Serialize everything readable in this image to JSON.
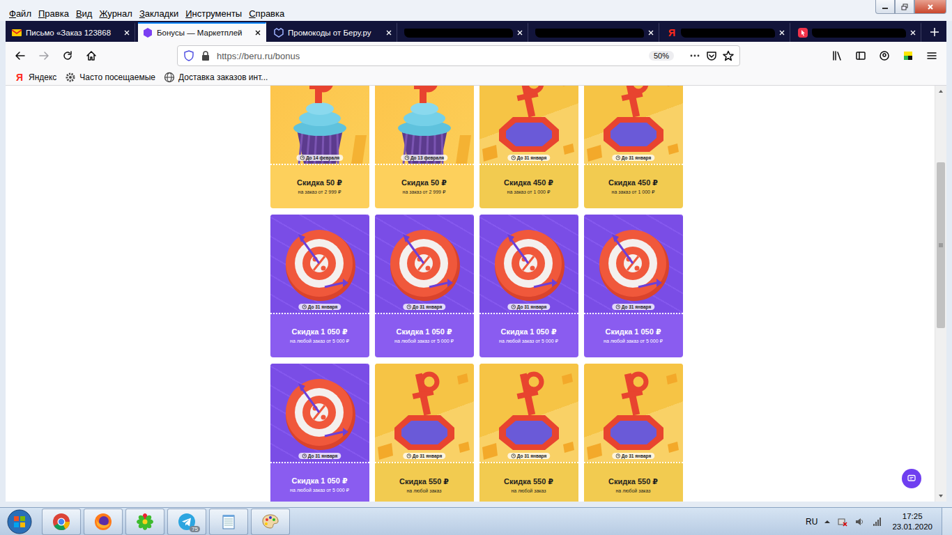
{
  "menu": [
    "Файл",
    "Правка",
    "Вид",
    "Журнал",
    "Закладки",
    "Инструменты",
    "Справка"
  ],
  "tabs": [
    {
      "label": "Письмо «Заказ 123868",
      "selected": false,
      "redacted": false,
      "icon_text": ""
    },
    {
      "label": "Бонусы — Маркетплей",
      "selected": true,
      "redacted": false,
      "icon_text": ""
    },
    {
      "label": "Промокоды от Беру.ру",
      "selected": false,
      "redacted": false,
      "icon_text": ""
    },
    {
      "label": "",
      "selected": false,
      "redacted": true,
      "icon_text": ""
    },
    {
      "label": "",
      "selected": false,
      "redacted": true,
      "icon_text": ""
    },
    {
      "label": "",
      "selected": false,
      "redacted": true,
      "icon_text": "Я"
    },
    {
      "label": "",
      "selected": false,
      "redacted": true,
      "icon_text": ""
    }
  ],
  "address": {
    "url": "https://beru.ru/bonus",
    "zoom": "50%"
  },
  "bookmarks": [
    {
      "label": "Яндекс",
      "icon_text": "Я"
    },
    {
      "label": "Часто посещаемые",
      "icon_text": ""
    },
    {
      "label": "Доставка заказов инт...",
      "icon_text": ""
    }
  ],
  "cards": [
    {
      "kind": "cupcake",
      "expires": "До 14 февраля",
      "title": "Скидка 50 ₽",
      "condition": "на заказ от 2 999 ₽",
      "color": "#fdd05c"
    },
    {
      "kind": "cupcake",
      "expires": "До 13 февраля",
      "title": "Скидка 50 ₽",
      "condition": "на заказ от 2 999 ₽",
      "color": "#fdd05c"
    },
    {
      "kind": "pool",
      "expires": "До 31 января",
      "title": "Скидка 450 ₽",
      "condition": "на заказ от 1 000 ₽",
      "color": "#f2cb50"
    },
    {
      "kind": "pool",
      "expires": "До 31 января",
      "title": "Скидка 450 ₽",
      "condition": "на заказ от 1 000 ₽",
      "color": "#f2cb50"
    },
    {
      "kind": "target",
      "expires": "До 31 января",
      "title": "Скидка 1 050 ₽",
      "condition": "на любой заказ от 5 000 ₽",
      "color": "#8a5cf0"
    },
    {
      "kind": "target",
      "expires": "До 31 января",
      "title": "Скидка 1 050 ₽",
      "condition": "на любой заказ от 5 000 ₽",
      "color": "#8a5cf0"
    },
    {
      "kind": "target",
      "expires": "До 31 января",
      "title": "Скидка 1 050 ₽",
      "condition": "на любой заказ от 5 000 ₽",
      "color": "#8a5cf0"
    },
    {
      "kind": "target",
      "expires": "До 31 января",
      "title": "Скидка 1 050 ₽",
      "condition": "на любой заказ от 5 000 ₽",
      "color": "#8a5cf0"
    },
    {
      "kind": "target",
      "expires": "До 31 января",
      "title": "Скидка 1 050 ₽",
      "condition": "на любой заказ от 5 000 ₽",
      "color": "#8a5cf0"
    },
    {
      "kind": "pool",
      "expires": "До 31 января",
      "title": "Скидка 550 ₽",
      "condition": "на любой заказ",
      "color": "#f2cb50"
    },
    {
      "kind": "pool",
      "expires": "До 31 января",
      "title": "Скидка 550 ₽",
      "condition": "на любой заказ",
      "color": "#f2cb50"
    },
    {
      "kind": "pool",
      "expires": "До 31 января",
      "title": "Скидка 550 ₽",
      "condition": "на любой заказ",
      "color": "#f2cb50"
    }
  ],
  "scroll": {
    "thumb_start": 0.167,
    "thumb_size": 0.42
  },
  "taskbar": {
    "apps": [
      {
        "badge": ""
      },
      {
        "badge": ""
      },
      {
        "badge": ""
      },
      {
        "badge": "75"
      },
      {
        "badge": ""
      },
      {
        "badge": ""
      }
    ]
  },
  "tray": {
    "language": "RU",
    "time": "17:25",
    "date": "23.01.2020"
  }
}
